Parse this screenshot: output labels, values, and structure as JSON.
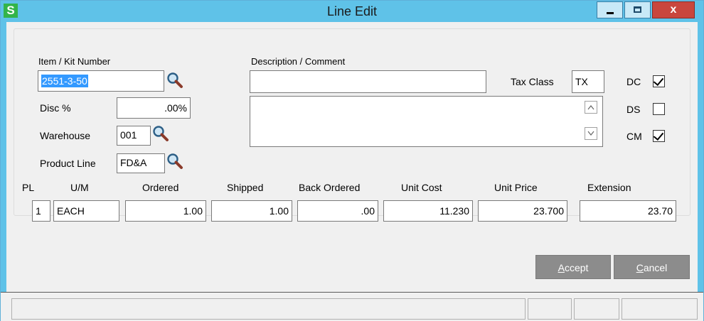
{
  "window": {
    "title": "Line Edit",
    "app_icon_letter": "S",
    "close_glyph": "x"
  },
  "fields": {
    "item_kit_label": "Item / Kit Number",
    "item_kit_value": "2551-3-50",
    "disc_label": "Disc %",
    "disc_value": ".00%",
    "warehouse_label": "Warehouse",
    "warehouse_value": "001",
    "product_line_label": "Product Line",
    "product_line_value": "FD&A",
    "description_label": "Description / Comment",
    "description_value": "",
    "comment_value": "",
    "tax_class_label": "Tax Class",
    "tax_class_value": "TX",
    "dc_label": "DC",
    "dc_checked": true,
    "ds_label": "DS",
    "ds_checked": false,
    "cm_label": "CM",
    "cm_checked": true
  },
  "grid": {
    "headers": {
      "pl": "PL",
      "um": "U/M",
      "ordered": "Ordered",
      "shipped": "Shipped",
      "back_ordered": "Back Ordered",
      "unit_cost": "Unit Cost",
      "unit_price": "Unit Price",
      "extension": "Extension"
    },
    "row": {
      "pl": "1",
      "um": "EACH",
      "ordered": "1.00",
      "shipped": "1.00",
      "back_ordered": ".00",
      "unit_cost": "11.230",
      "unit_price": "23.700",
      "extension": "23.70"
    }
  },
  "buttons": {
    "accept_hotkey": "A",
    "accept_rest": "ccept",
    "cancel_hotkey": "C",
    "cancel_rest": "ancel"
  },
  "icons": {
    "lookup": "magnifier-icon",
    "scroll_up": "chevron-up-icon",
    "scroll_down": "chevron-down-icon"
  },
  "colors": {
    "titlebar": "#5fc2e8",
    "app_icon": "#33b44a",
    "close_button": "#c9463d",
    "selection": "#3399ff",
    "action_button": "#8c8c8c"
  }
}
